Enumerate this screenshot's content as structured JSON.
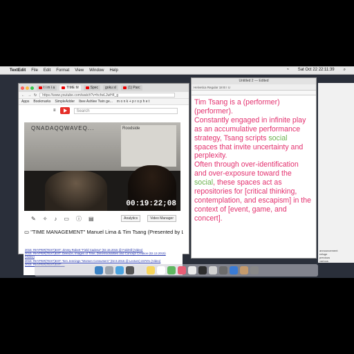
{
  "menubar": {
    "app": "TextEdit",
    "items": [
      "File",
      "Edit",
      "Format",
      "View",
      "Window",
      "Help"
    ],
    "clock": "Sat Oct 22  22:11:39"
  },
  "browser": {
    "tabs": [
      "t i m i a",
      "TIME M",
      "Spec",
      "goku sl",
      "(1) Parc"
    ],
    "url": "https://www.youtube.com/watch?v=hcheLJwH4_g",
    "bookmarks": [
      "Apps",
      "Bookmarks",
      "SimpleAdder",
      "Ibee Ashlee Twin ge...",
      "m o n k + p r o p h e t"
    ],
    "search_placeholder": "Search",
    "video": {
      "projection_title": "QNADAQQWAVEQ...",
      "projection_right": "Roodside",
      "timecode": "00:19:22;08"
    },
    "controls": {
      "analytics": "Analytics",
      "video_manager": "Video Manager"
    },
    "video_title": "\"TIME MANAGEMENT\" Manuel Lima & Tim Tsang (Presented by L"
  },
  "background_list": [
    "2015: RHYPER(TEXT)EXT: Jimmy Robert \"Field Cadena\" (02.15.2015 @ FoldHill (Video)",
    "2015: RHYPER(TEXT)EXT: Deleuze, Images of Time, Dimensionalities and Concept Creation (02.13.2015)",
    "(Video)",
    "2015: RHYPER(TEXT)EXT: Tom Jennings \"Women Consumers\" (02.9.2015 @ Lecture) 2374% (Video)",
    "2015: RHYPER(TEXT)EXT: ..."
  ],
  "textedit": {
    "title": "Untitled 2 — Edited",
    "toolbar": "Helvetica  Regular  18  B I U",
    "segments": [
      {
        "text": "Tim Tsang is a (performer)\n(performer).\nConstantly engaged in infinite play as an accumulative performance strategy, Tsang scripts ",
        "style": "pink"
      },
      {
        "text": "social",
        "style": "green"
      },
      {
        "text": " spaces that invite uncertainty and perplexity.\nOften through over-identification and over-exposure toward the ",
        "style": "pink"
      },
      {
        "text": "social",
        "style": "green"
      },
      {
        "text": ", these spaces act as repositories for [critical thinking, contemplation, and escapism] in the context of [event, game, and concert].",
        "style": "pink"
      }
    ]
  },
  "right_panel_words": [
    "announcement",
    "refuge",
    "precious",
    "various"
  ],
  "colors": {
    "text_pink": "#e3306e",
    "text_green": "#6ab04c",
    "youtube_red": "#e52d27"
  }
}
